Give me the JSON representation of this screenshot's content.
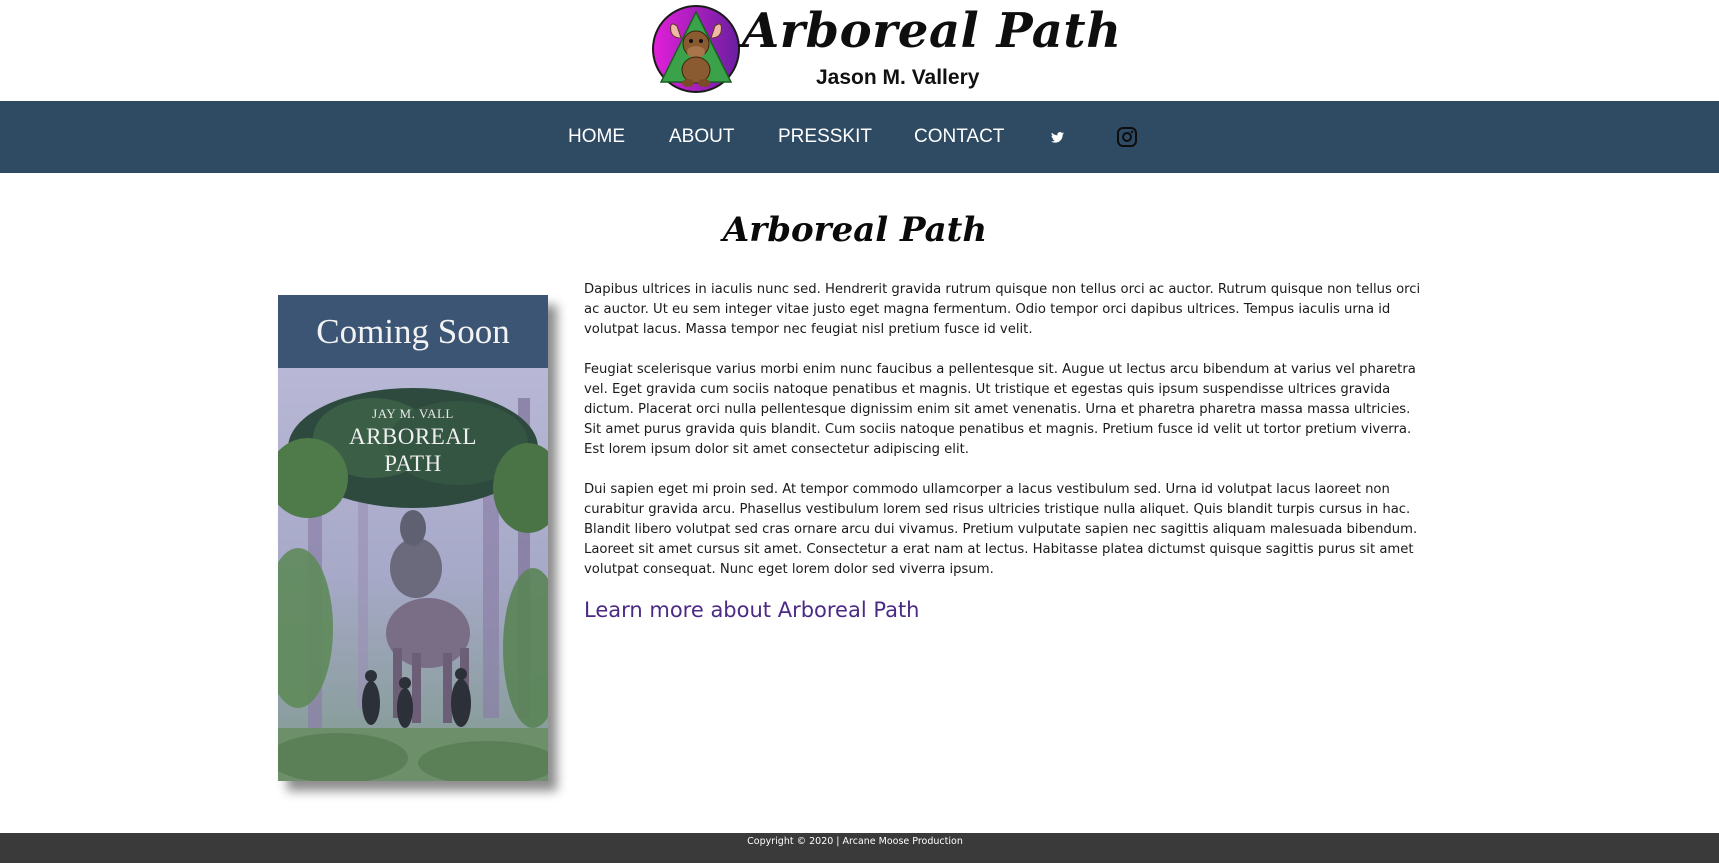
{
  "header": {
    "title": "Arboreal Path",
    "author": "Jason M. Vallery"
  },
  "nav": {
    "items": [
      {
        "label": "HOME"
      },
      {
        "label": "ABOUT"
      },
      {
        "label": "PRESSKIT"
      },
      {
        "label": "CONTACT"
      }
    ],
    "social": [
      {
        "icon": "twitter-icon"
      },
      {
        "icon": "instagram-icon"
      }
    ]
  },
  "main": {
    "heading": "Arboreal Path",
    "cover": {
      "banner": "Coming Soon",
      "author": "JAY M. VALL",
      "title_line1": "ARBOREAL",
      "title_line2": "PATH"
    },
    "paragraphs": [
      "Dapibus ultrices in iaculis nunc sed. Hendrerit gravida rutrum quisque non tellus orci ac auctor. Rutrum quisque non tellus orci ac auctor. Ut eu sem integer vitae justo eget magna fermentum. Odio tempor orci dapibus ultrices. Tempus iaculis urna id volutpat lacus. Massa tempor nec feugiat nisl pretium fusce id velit.",
      "Feugiat scelerisque varius morbi enim nunc faucibus a pellentesque sit. Augue ut lectus arcu bibendum at varius vel pharetra vel. Eget gravida cum sociis natoque penatibus et magnis. Ut tristique et egestas quis ipsum suspendisse ultrices gravida dictum. Placerat orci nulla pellentesque dignissim enim sit amet venenatis. Urna et pharetra pharetra massa massa ultricies. Sit amet purus gravida quis blandit. Cum sociis natoque penatibus et magnis. Pretium fusce id velit ut tortor pretium viverra. Est lorem ipsum dolor sit amet consectetur adipiscing elit.",
      "Dui sapien eget mi proin sed. At tempor commodo ullamcorper a lacus vestibulum sed. Urna id volutpat lacus laoreet non curabitur gravida arcu. Phasellus vestibulum lorem sed risus ultricies tristique nulla aliquet. Quis blandit turpis cursus in hac. Blandit libero volutpat sed cras ornare arcu dui vivamus. Pretium vulputate sapien nec sagittis aliquam malesuada bibendum. Laoreet sit amet cursus sit amet. Consectetur a erat nam at lectus. Habitasse platea dictumst quisque sagittis purus sit amet volutpat consequat. Nunc eget lorem dolor sed viverra ipsum."
    ],
    "learn_more": "Learn more about Arboreal Path"
  },
  "footer": {
    "copyright": "Copyright © 2020 | Arcane Moose Production"
  },
  "colors": {
    "nav_bg": "#2f4a63",
    "footer_bg": "#3a3a3a",
    "link": "#4b2a86",
    "cover_banner": "#3d5574"
  }
}
